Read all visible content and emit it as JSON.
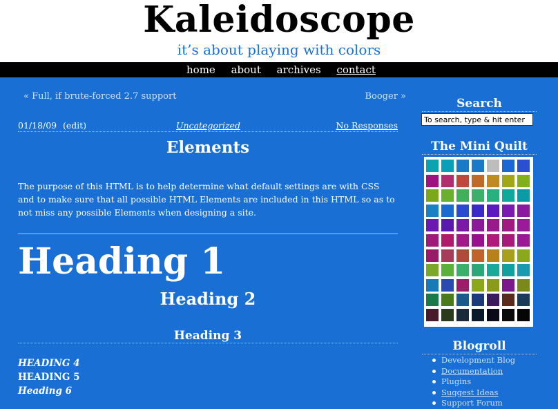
{
  "header": {
    "title": "Kaleidoscope",
    "tagline": "it’s about playing with colors"
  },
  "nav": [
    {
      "label": "home"
    },
    {
      "label": "about"
    },
    {
      "label": "archives"
    },
    {
      "label": "contact"
    }
  ],
  "post_nav": {
    "prev": "« Full, if brute-forced 2.7 support",
    "next": "Booger »"
  },
  "meta": {
    "date": "01/18/09",
    "edit": "(edit)",
    "category": "Uncategorized",
    "responses": "No Responses"
  },
  "post": {
    "title": "Elements",
    "intro": "The purpose of this HTML is to help determine what default settings are with CSS and to make sure that all possible HTML Elements are included in this HTML so as to not miss any possible Elements when designing a site.",
    "h1": "Heading 1",
    "h2": "Heading 2",
    "h3": "Heading 3",
    "h4": "Heading 4",
    "h5": "Heading 5",
    "h6": "Heading 6"
  },
  "sidebar": {
    "search_title": "Search",
    "search_placeholder": "To search, type & hit enter",
    "quilt_title": "The Mini Quilt",
    "blogroll_title": "Blogroll",
    "blogroll": [
      {
        "label": "Development Blog"
      },
      {
        "label": "Documentation"
      },
      {
        "label": "Plugins"
      },
      {
        "label": "Suggest Ideas"
      },
      {
        "label": "Support Forum"
      }
    ]
  },
  "quilt_colors": [
    [
      "#0aa3b0",
      "#0a9fb8",
      "#1a7ac8",
      "#1a7ac8",
      "#bdbdbd",
      "#1a68d4",
      "#2a4fd0"
    ],
    [
      "#a0127e",
      "#b22d6e",
      "#c0493e",
      "#c06a2a",
      "#c08a22",
      "#a0a81a",
      "#82b01a"
    ],
    [
      "#7aa81a",
      "#6ab02e",
      "#40b05a",
      "#3cb06a",
      "#28b07e",
      "#10a89a",
      "#0a9aa8"
    ],
    [
      "#1a82c0",
      "#1a6ad0",
      "#2a4ad0",
      "#3a2ac8",
      "#5a1ac0",
      "#7a1ab0",
      "#8a1aa0"
    ],
    [
      "#6a1ab0",
      "#5a1ab0",
      "#7a1aa8",
      "#8a1a98",
      "#9a1a8a",
      "#a01a80",
      "#9a1a9a"
    ],
    [
      "#a01a7a",
      "#b01a6a",
      "#a01a8a",
      "#98108e",
      "#b01a7a",
      "#a81a7a",
      "#9a1a96"
    ],
    [
      "#9a1a6a",
      "#a83a5a",
      "#b04a3a",
      "#c0622a",
      "#b8821a",
      "#a8a01a",
      "#8aa81a"
    ],
    [
      "#7aa82a",
      "#5ab03a",
      "#3ab06a",
      "#2aa87a",
      "#1aa89a",
      "#10a0a0",
      "#1a9ab0"
    ],
    [
      "#1a7ab8",
      "#2a4ab0",
      "#a01a6a",
      "#8aa81a",
      "#8a9a1a",
      "#7a1a8a",
      "#7a8a1a"
    ],
    [
      "#1a7a4a",
      "#4a7a1a",
      "#1a5a8a",
      "#1a3a7a",
      "#3a1a5a",
      "#5a2a1a",
      "#1a3a5a"
    ],
    [
      "#4a1a2a",
      "#2a3a1a",
      "#1a2a3a",
      "#0a1a2a",
      "#0a0a1a",
      "#0a0a0a",
      "#050505"
    ]
  ]
}
